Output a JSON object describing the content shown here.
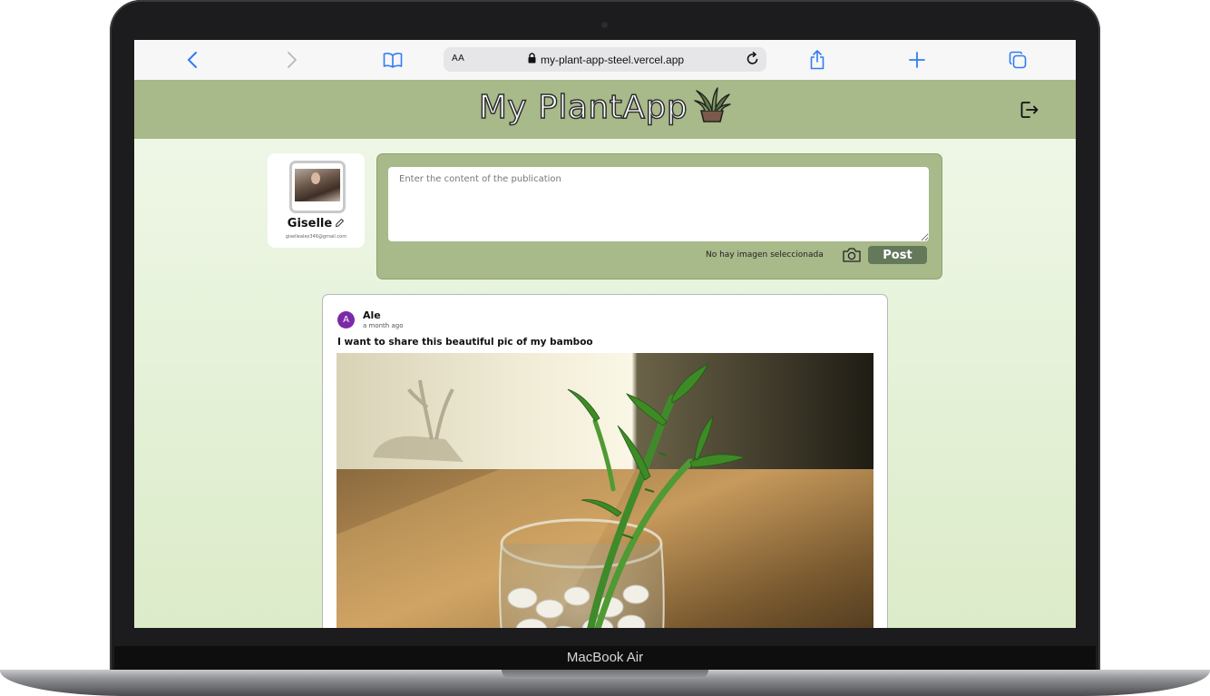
{
  "device": {
    "label": "MacBook Air"
  },
  "browser": {
    "text_size_label": "AA",
    "url": "my-plant-app-steel.vercel.app"
  },
  "app": {
    "title": "My PlantApp",
    "colors": {
      "header": "#a8b98a",
      "post_button": "#64785a",
      "background": "#e3f0d4"
    }
  },
  "profile": {
    "name": "Giselle",
    "email": "gisellealex346@gmail.com"
  },
  "composer": {
    "placeholder": "Enter the content of the publication",
    "no_image_text": "No hay imagen seleccionada",
    "post_label": "Post"
  },
  "post": {
    "avatar_initial": "A",
    "author": "Ale",
    "time": "a month ago",
    "text": "I want to share this beautiful pic of my bamboo"
  },
  "icons": [
    "back-icon",
    "forward-icon",
    "bookmarks-icon",
    "lock-icon",
    "reload-icon",
    "share-icon",
    "new-tab-icon",
    "tabs-icon",
    "plant-pot-icon",
    "logout-icon",
    "edit-pencil-icon",
    "camera-icon"
  ]
}
